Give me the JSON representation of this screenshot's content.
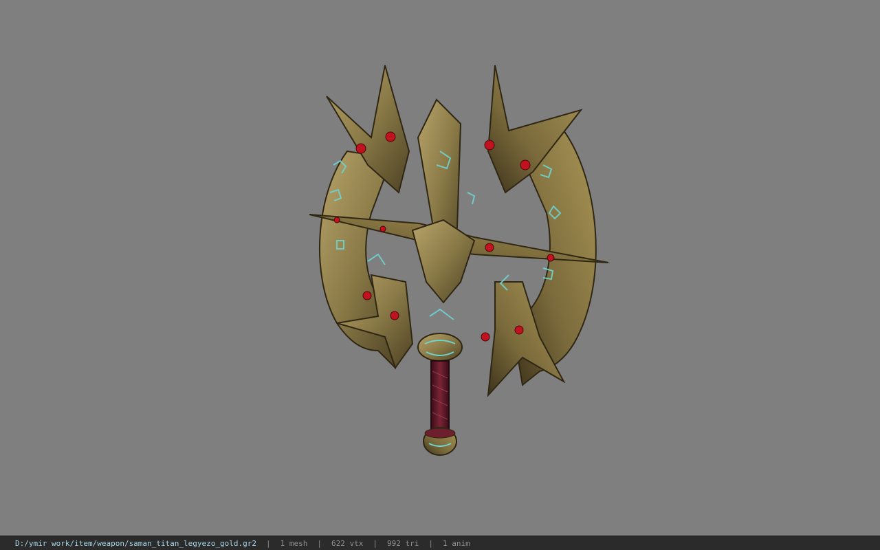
{
  "viewport": {
    "background": "#7f7f7f",
    "model": {
      "icon": "battle-axe-model",
      "metal_color": "#8a7a47",
      "rune_color": "#6fd3d0",
      "gem_color": "#c1121f",
      "grip_color": "#6d1f2e"
    }
  },
  "status": {
    "file_path": "D:/ymir work/item/weapon/saman_titan_legyezo_gold.gr2",
    "separator": "|",
    "mesh_count": "1 mesh",
    "vertex_count": "622 vtx",
    "triangle_count": "992 tri",
    "anim_count": "1 anim"
  }
}
